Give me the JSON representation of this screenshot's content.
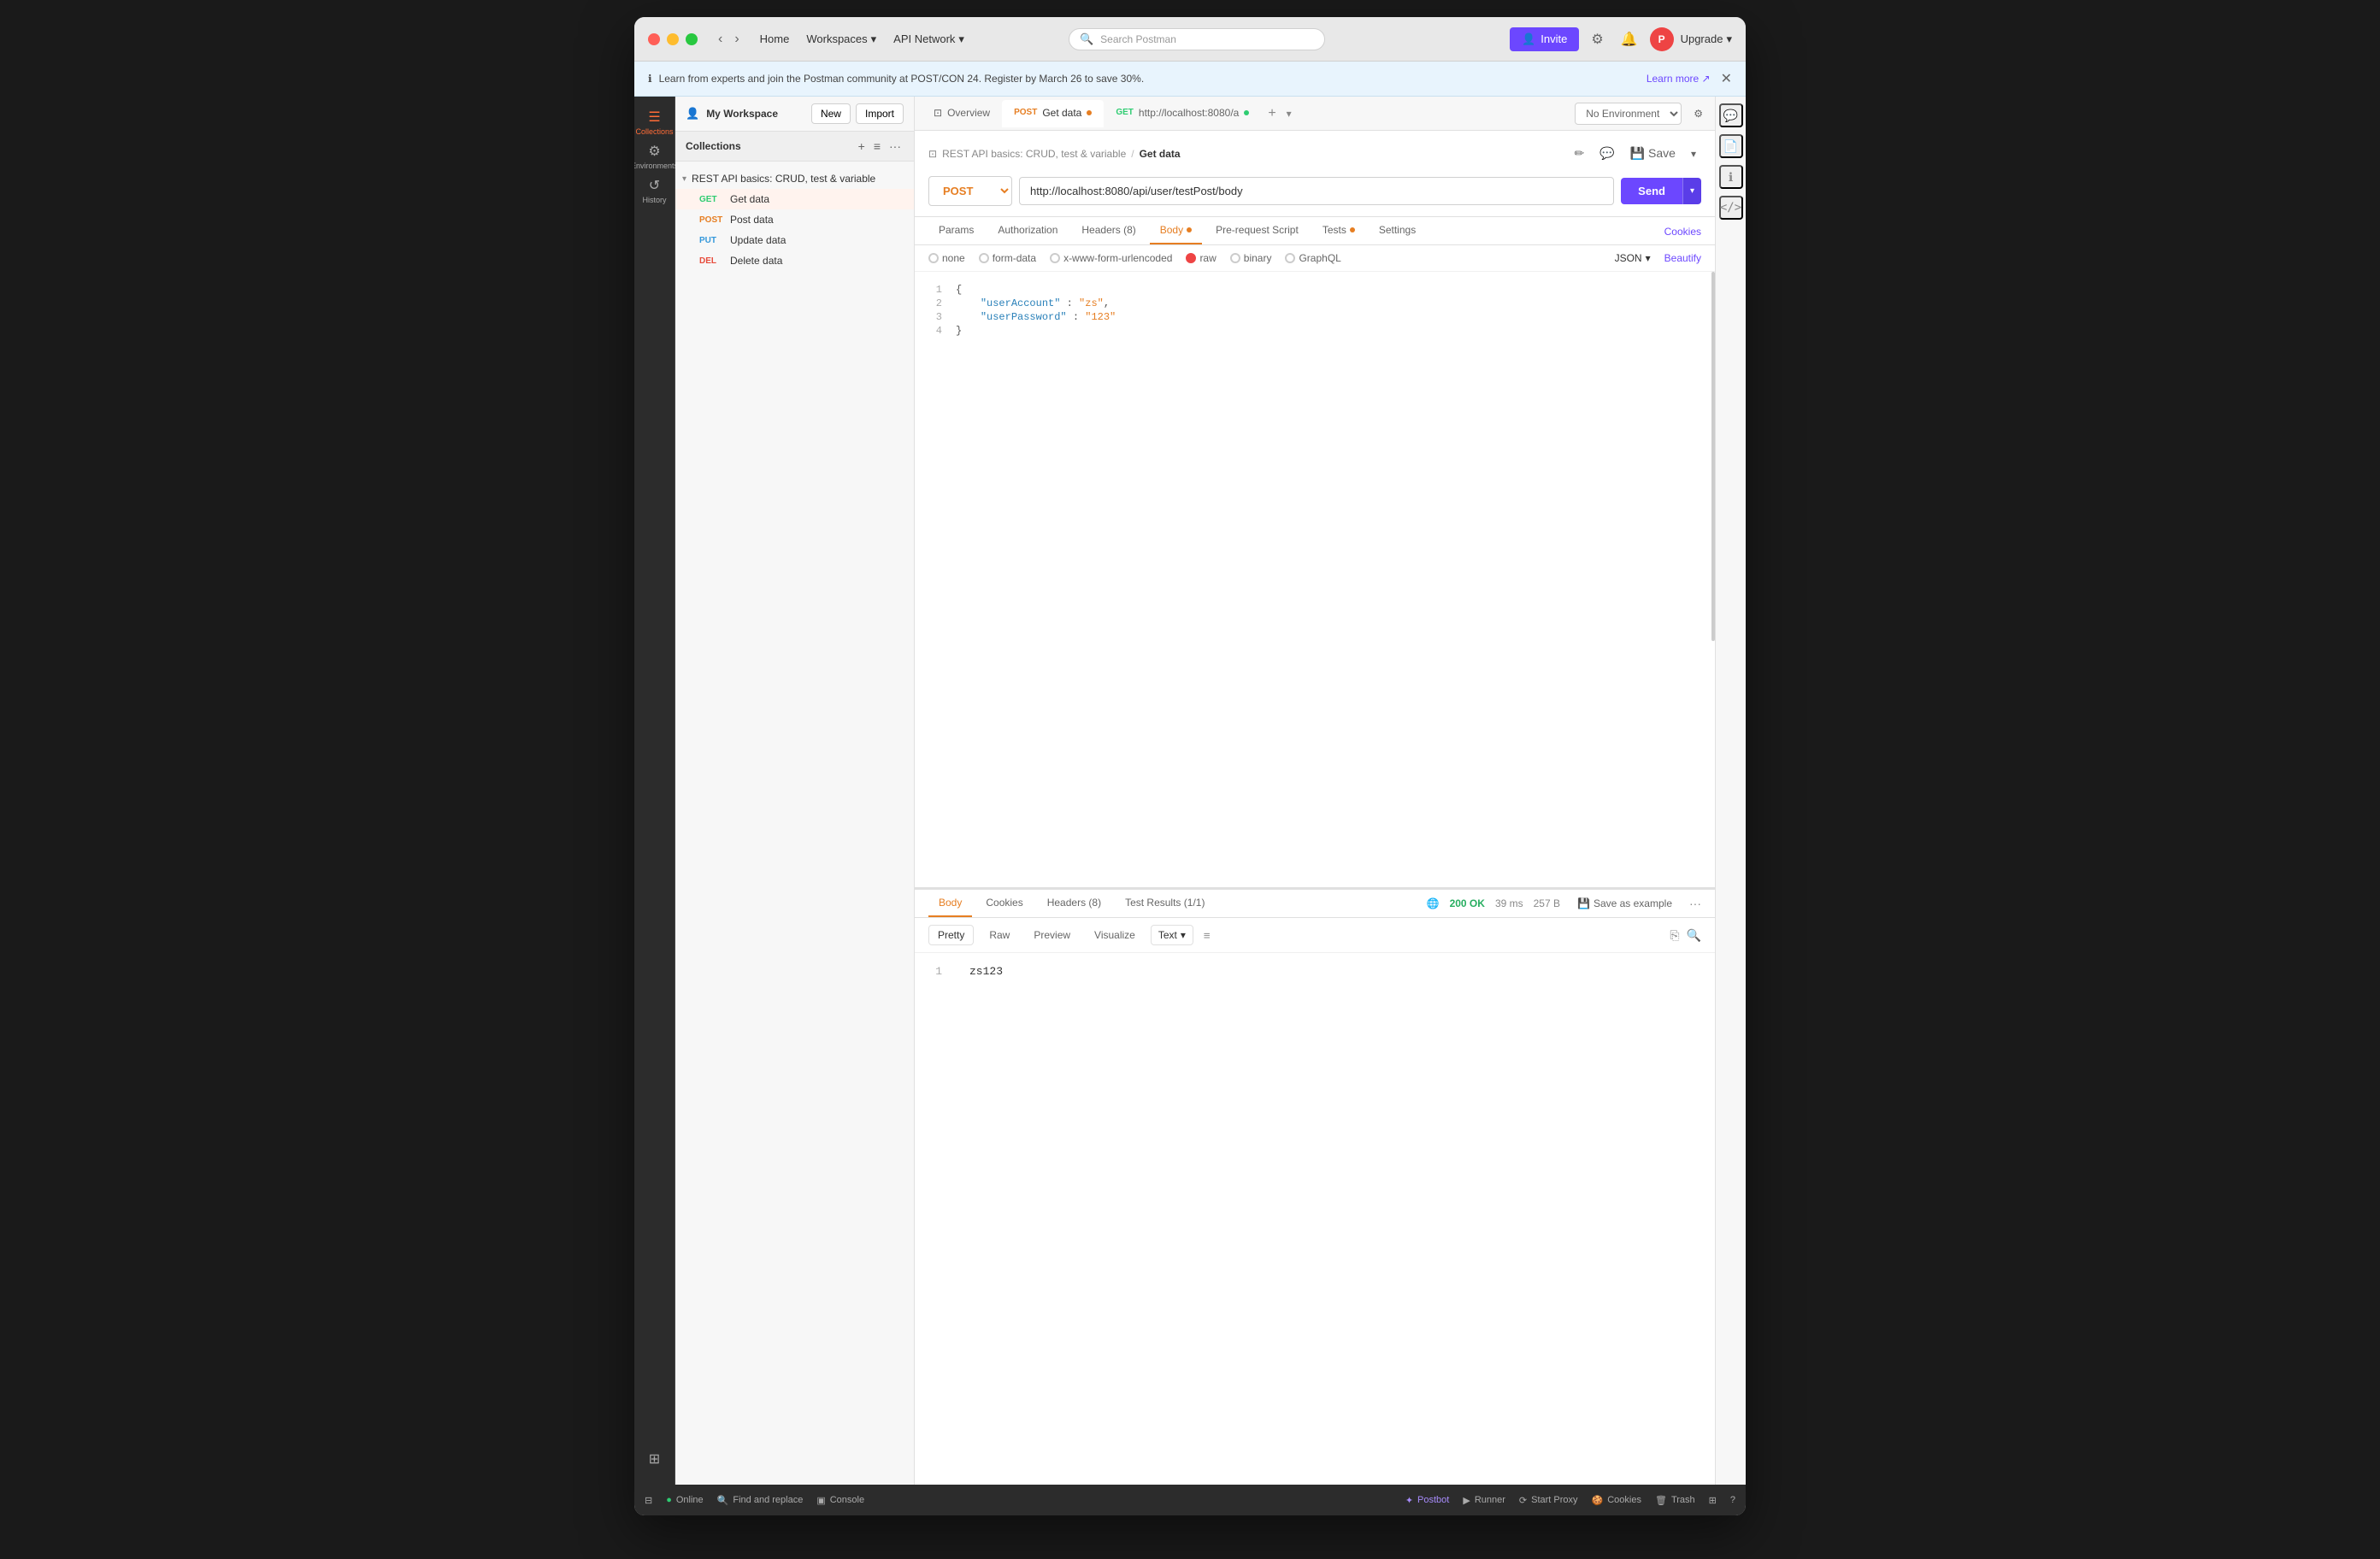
{
  "window": {
    "title": "Postman"
  },
  "titlebar": {
    "nav": {
      "home": "Home",
      "workspaces": "Workspaces",
      "api_network": "API Network"
    },
    "search_placeholder": "Search Postman",
    "invite_label": "Invite",
    "upgrade_label": "Upgrade"
  },
  "banner": {
    "text": "Learn from experts and join the Postman community at POST/CON 24. Register by March 26 to save 30%.",
    "learn_more": "Learn more ↗",
    "icon": "ℹ"
  },
  "sidebar": {
    "items": [
      {
        "icon": "☰",
        "label": "Collections",
        "active": true
      },
      {
        "icon": "⚙",
        "label": "Environments",
        "active": false
      },
      {
        "icon": "↺",
        "label": "History",
        "active": false
      },
      {
        "icon": "⊞",
        "label": "More",
        "active": false
      }
    ]
  },
  "workspace": {
    "name": "My Workspace",
    "new_label": "New",
    "import_label": "Import"
  },
  "collection": {
    "name": "REST API basics: CRUD, test & variable",
    "requests": [
      {
        "method": "GET",
        "name": "Get data",
        "active": true
      },
      {
        "method": "POST",
        "name": "Post data",
        "active": false
      },
      {
        "method": "PUT",
        "name": "Update data",
        "active": false
      },
      {
        "method": "DELETE",
        "name": "Delete data",
        "active": false
      }
    ]
  },
  "tabs": [
    {
      "type": "overview",
      "label": "Overview"
    },
    {
      "type": "post",
      "method": "POST",
      "label": "Get data",
      "active": true,
      "dot": true
    },
    {
      "type": "get",
      "method": "GET",
      "label": "http://localhost:8080/a",
      "dot": true
    }
  ],
  "environment": {
    "label": "No Environment"
  },
  "request": {
    "breadcrumb": {
      "collection": "REST API basics: CRUD, test & variable",
      "separator": "/",
      "current": "Get data"
    },
    "method": "POST",
    "url": "http://localhost:8080/api/user/testPost/body",
    "send_label": "Send",
    "tabs": [
      {
        "label": "Params",
        "active": false
      },
      {
        "label": "Authorization",
        "active": false
      },
      {
        "label": "Headers (8)",
        "active": false
      },
      {
        "label": "Body",
        "active": true,
        "dot": true
      },
      {
        "label": "Pre-request Script",
        "active": false
      },
      {
        "label": "Tests",
        "active": false,
        "dot": true
      },
      {
        "label": "Settings",
        "active": false
      }
    ],
    "cookies_label": "Cookies",
    "body_options": [
      {
        "label": "none",
        "selected": false
      },
      {
        "label": "form-data",
        "selected": false
      },
      {
        "label": "x-www-form-urlencoded",
        "selected": false
      },
      {
        "label": "raw",
        "selected": true
      },
      {
        "label": "binary",
        "selected": false
      },
      {
        "label": "GraphQL",
        "selected": false
      }
    ],
    "format": "JSON",
    "beautify_label": "Beautify",
    "body_code": [
      {
        "line": 1,
        "content": "{"
      },
      {
        "line": 2,
        "content": "    \"userAccount\" : \"zs\","
      },
      {
        "line": 3,
        "content": "    \"userPassword\" : \"123\""
      },
      {
        "line": 4,
        "content": "}"
      }
    ]
  },
  "response": {
    "tabs": [
      {
        "label": "Body",
        "active": true
      },
      {
        "label": "Cookies",
        "active": false
      },
      {
        "label": "Headers (8)",
        "active": false
      },
      {
        "label": "Test Results (1/1)",
        "active": false
      }
    ],
    "status": "200 OK",
    "time": "39 ms",
    "size": "257 B",
    "save_example_label": "Save as example",
    "format_tabs": [
      {
        "label": "Pretty",
        "active": true
      },
      {
        "label": "Raw",
        "active": false
      },
      {
        "label": "Preview",
        "active": false
      },
      {
        "label": "Visualize",
        "active": false
      }
    ],
    "format_type": "Text",
    "body_lines": [
      {
        "line": 1,
        "content": "zs123"
      }
    ]
  },
  "bottombar": {
    "left": [
      {
        "icon": "⊟",
        "label": ""
      },
      {
        "icon": "●",
        "label": "Online"
      },
      {
        "icon": "🔍",
        "label": "Find and replace"
      },
      {
        "icon": "▣",
        "label": "Console"
      }
    ],
    "right": [
      {
        "icon": "✦",
        "label": "Postbot",
        "special": "postbot"
      },
      {
        "icon": "▶",
        "label": "Runner"
      },
      {
        "icon": "⟳",
        "label": "Start Proxy"
      },
      {
        "icon": "🍪",
        "label": "Cookies"
      },
      {
        "icon": "🗑",
        "label": "Trash"
      },
      {
        "icon": "⊞",
        "label": ""
      },
      {
        "icon": "?",
        "label": ""
      }
    ]
  }
}
